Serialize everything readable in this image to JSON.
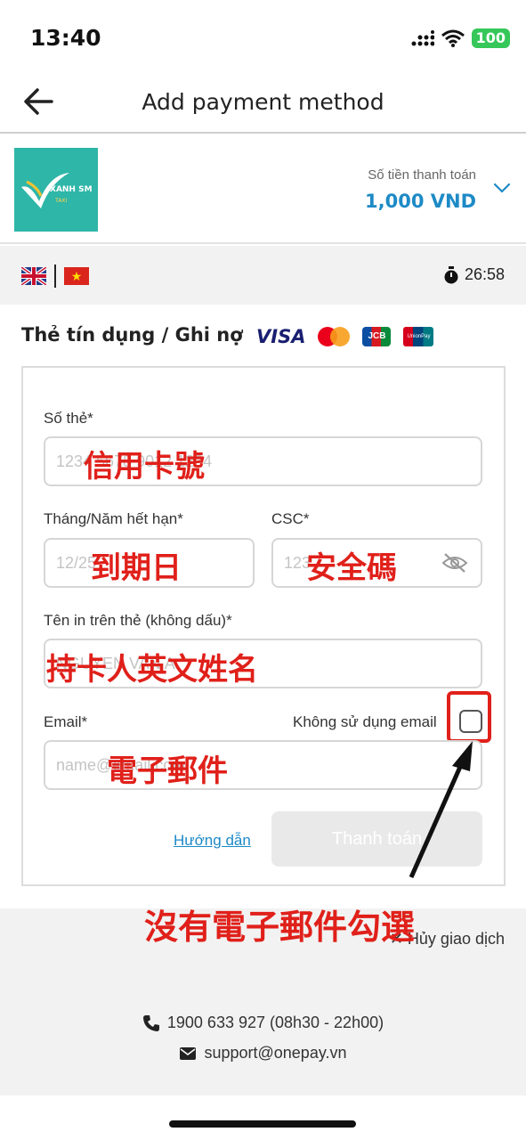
{
  "status_bar": {
    "time": "13:40",
    "battery": "100"
  },
  "header": {
    "title": "Add payment method"
  },
  "merchant": {
    "logo_text": "XANH SM",
    "logo_sub": "TAXI",
    "amount_label": "Số tiền thanh toán",
    "amount_value": "1,000 VND"
  },
  "session": {
    "timer": "26:58"
  },
  "card_section": {
    "title": "Thẻ tín dụng / Ghi nợ",
    "brands": [
      "VISA",
      "JCB",
      "UnionPay"
    ]
  },
  "form": {
    "card_number": {
      "label": "Số thẻ*",
      "placeholder": "1234 5678 9012 1234",
      "overlay": "信用卡號"
    },
    "expiry": {
      "label": "Tháng/Năm hết hạn*",
      "placeholder": "12/25",
      "overlay": "到期日"
    },
    "csc": {
      "label": "CSC*",
      "placeholder": "123",
      "overlay": "安全碼"
    },
    "cardholder": {
      "label": "Tên in trên thẻ (không dấu)*",
      "placeholder": "NGUYEN VAN A",
      "overlay": "持卡人英文姓名"
    },
    "email": {
      "label": "Email*",
      "placeholder": "name@email.com",
      "overlay": "電子郵件"
    },
    "no_email": {
      "label": "Không sử dụng email",
      "checked": false
    },
    "guide_link": "Hướng dẫn",
    "pay_button": "Thanh toán"
  },
  "annotation": {
    "no_email_note": "沒有電子郵件勾選"
  },
  "footer": {
    "cancel": "Hủy giao dịch",
    "phone": "1900 633 927 (08h30 - 22h00)",
    "email": "support@onepay.vn"
  },
  "colors": {
    "accent": "#1d8ac6",
    "annotation_red": "#e0201a",
    "logo_bg": "#2eb6a8"
  }
}
